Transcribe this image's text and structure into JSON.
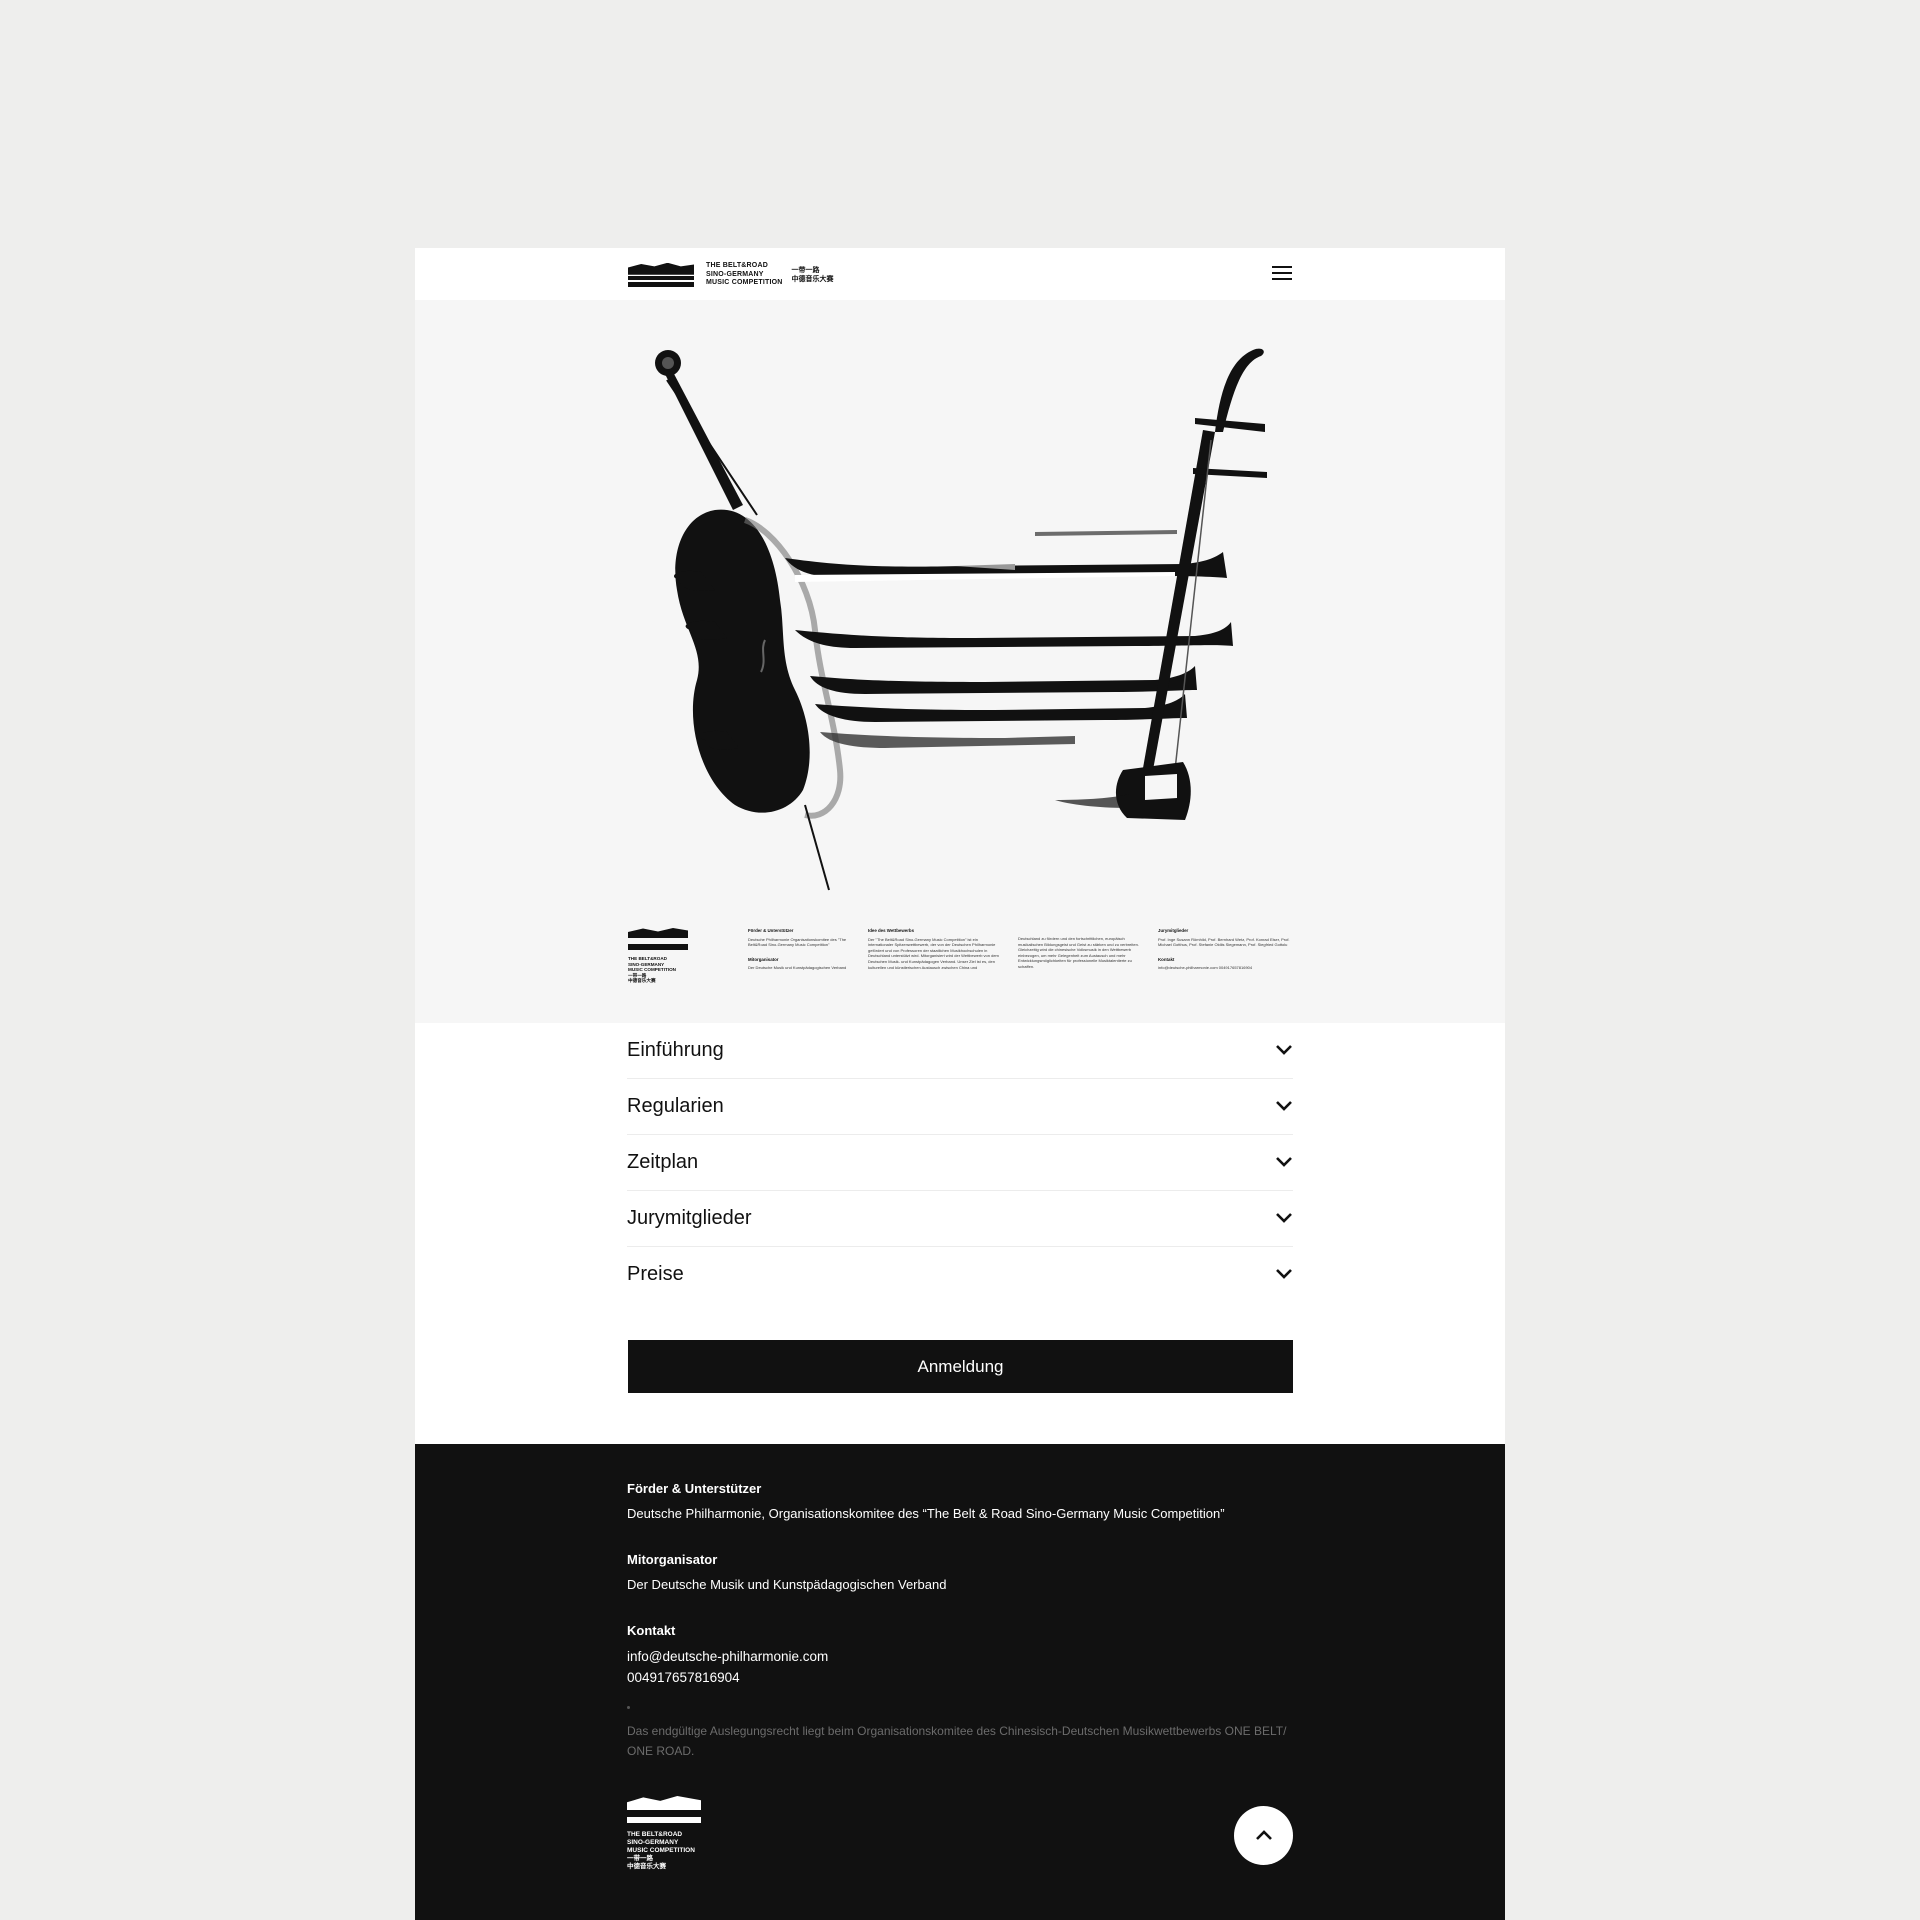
{
  "header": {
    "logo_line1": "THE BELT&ROAD",
    "logo_line2": "SINO-GERMANY",
    "logo_line3": "MUSIC COMPETITION",
    "logo_cn1": "一带一路",
    "logo_cn2": "中德音乐大赛",
    "menu_icon": "hamburger-icon"
  },
  "poster": {
    "logo_line1": "THE BELT&ROAD",
    "logo_line2": "SINO-GERMANY",
    "logo_line3": "MUSIC COMPETITION",
    "logo_cn1": "一带一路",
    "logo_cn2": "中德音乐大赛",
    "col1_head": "Förder & Unterstützer",
    "col1_text": "Deutsche Philharmonie Organisationskomitee des \"The Belt&Road Sino-Germany Music Competition\"",
    "col1_head2": "Mitorganisator",
    "col1_text2": "Der Deutsche Musik und Kunstpädagogischen Verband",
    "col2_head": "Idee des Wettbewerbs",
    "col2_text": "Der \"The Belt&Road Sino-Germany Music Competition\" ist ein internationaler Spitzenwettbewerb, der von der Deutschen Philharmonie gefördert und von Professoren der staatlichen Musikhochschulen in Deutschland unterstützt wird. Mitorganisiert wird der Wettbewerb von dem Deutschen Musik- und Kunstpädagogen Verband. Unser Ziel ist es, den kulturellen und künstlerischen Austausch zwischen China und",
    "col3_text": "Deutschland zu fördern und den fortschrittlichen, europäisch musikalischen Bildungsgeist und Geist zu stärken und zu verbreiten. Gleichzeitig wird die chinesische Volksmusik in den Wettbewerb einbezogen, um mehr Gelegenheit zum Austausch und mehr Entwicklungsmöglichkeiten für professionelle Musiktalentierte zu schaffen.",
    "col4_head": "Jurymitglieder",
    "col4_text": "Prof. Inge Susann Römhild, Prof. Bernhard Wetz, Prof. Konrad Elser, Prof. Michael Gotthus, Prof. Stefanie Oldiis Siegemann, Prof. Siegfried Gottolu",
    "col4_head2": "Kontakt",
    "col4_text2": "info@deutsche-philharmonie.com 004917657816904"
  },
  "accordion": {
    "items": [
      {
        "label": "Einführung"
      },
      {
        "label": "Regularien"
      },
      {
        "label": "Zeitplan"
      },
      {
        "label": "Jurymitglieder"
      },
      {
        "label": "Preise"
      }
    ]
  },
  "register": {
    "label": "Anmeldung"
  },
  "footer": {
    "sponsor_head": "Förder & Unterstützer",
    "sponsor_text": "Deutsche Philharmonie, Organisationskomitee des “The Belt & Road Sino-Germany Music Competition”",
    "coorg_head": "Mitorganisator",
    "coorg_text": "Der Deutsche Musik und Kunstpädagogischen Verband",
    "contact_head": "Kontakt",
    "contact_email": "info@deutsche-philharmonie.com",
    "contact_phone": "004917657816904",
    "legal": "Das endgültige Auslegungsrecht liegt beim Organisationskomitee des Chinesisch-Deutschen Musikwettbewerbs ONE BELT/ ONE ROAD.",
    "logo_line1": "THE BELT&ROAD",
    "logo_line2": "SINO-GERMANY",
    "logo_line3": "MUSIC COMPETITION",
    "logo_cn1": "一带一路",
    "logo_cn2": "中德音乐大赛",
    "top_icon": "chevron-up-icon"
  },
  "colors": {
    "background": "#eeeeed",
    "hero": "#f6f6f6",
    "dark": "#111111",
    "legal": "#6c6c6c"
  }
}
